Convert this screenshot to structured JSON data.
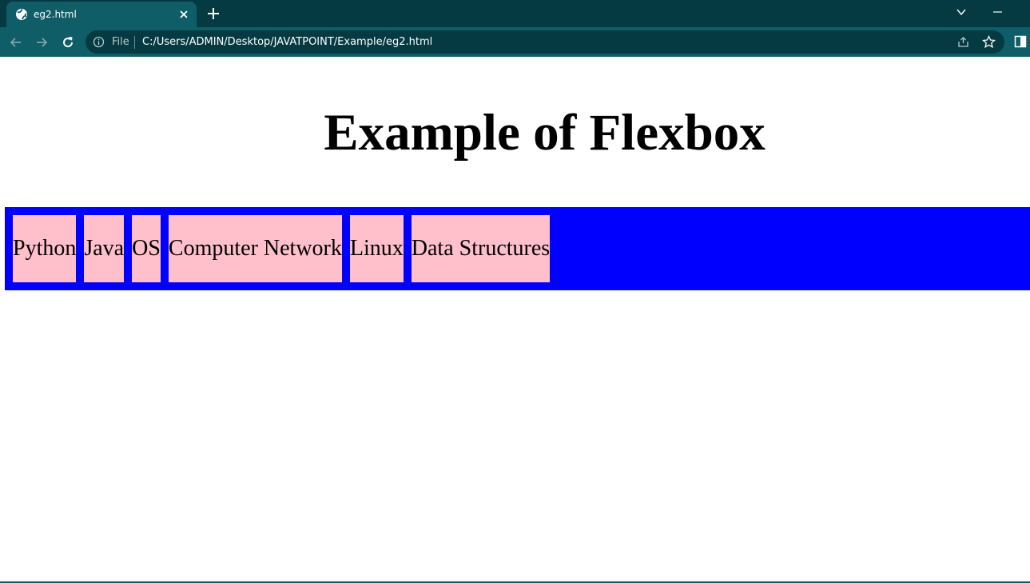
{
  "browser": {
    "tab_title": "eg2.html",
    "omnibox_chip": "File",
    "url": "C:/Users/ADMIN/Desktop/JAVATPOINT/Example/eg2.html",
    "colors": {
      "tabbar": "#053a42",
      "toolbar": "#0f5d66"
    }
  },
  "page": {
    "heading": "Example of Flexbox",
    "flex_items": [
      "Python",
      "Java",
      "OS",
      "Computer Network",
      "Linux",
      "Data Structures"
    ],
    "colors": {
      "container": "#0000ff",
      "item": "#ffc0cb"
    }
  }
}
